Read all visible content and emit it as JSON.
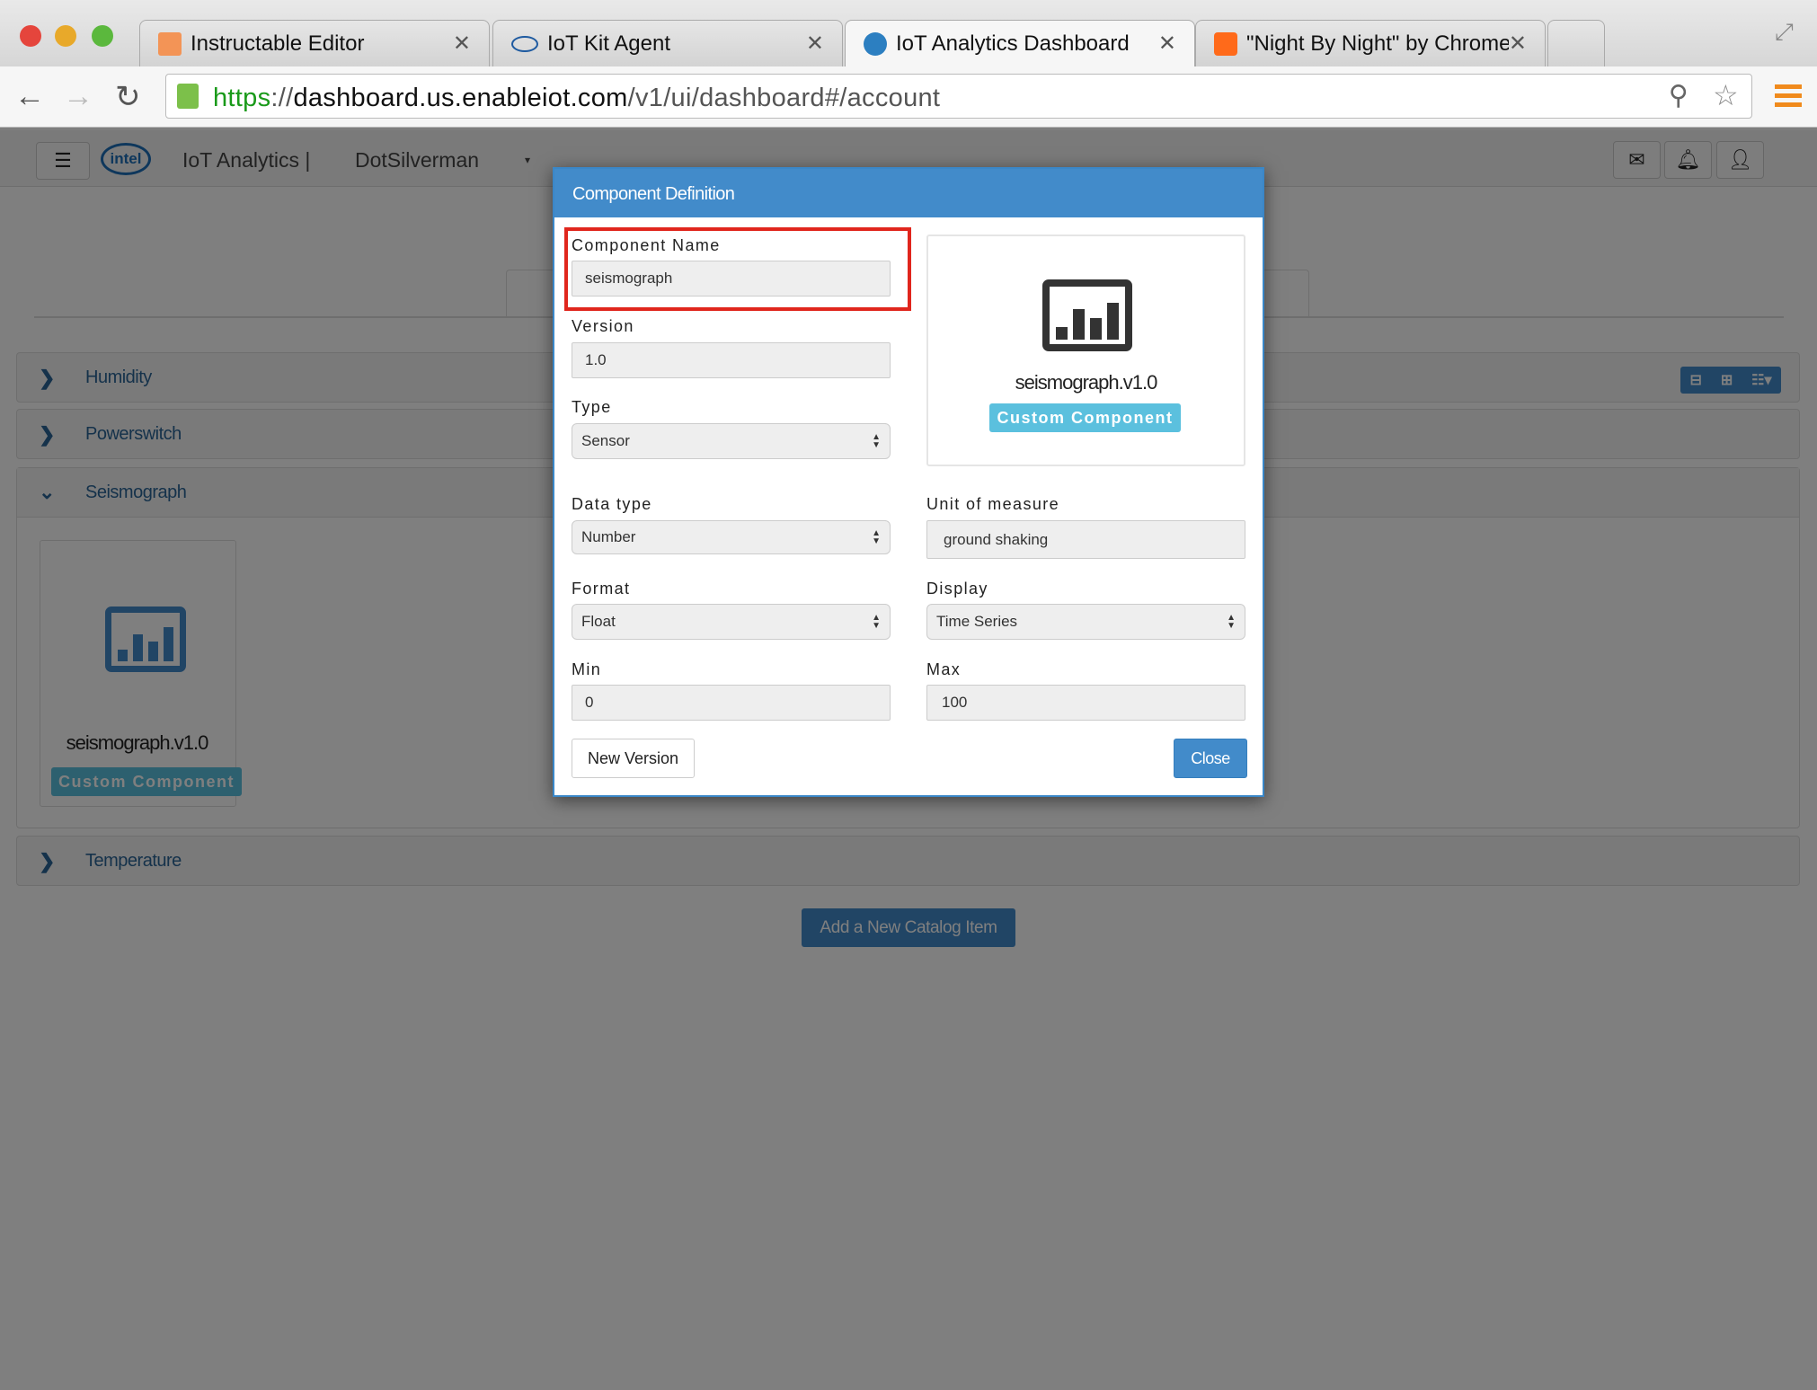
{
  "browser": {
    "tabs": [
      {
        "title": "Instructable Editor",
        "active": false,
        "favicon": "instructables-icon",
        "color": "#f39456"
      },
      {
        "title": "IoT Kit Agent",
        "active": false,
        "favicon": "intel-icon",
        "color": "#1e5aa0"
      },
      {
        "title": "IoT Analytics Dashboard",
        "active": true,
        "favicon": "globe-icon",
        "color": "#2c7fc1"
      },
      {
        "title": "\"Night By Night\" by Chrome",
        "active": false,
        "favicon": "soundcloud-icon",
        "color": "#ff6a1a"
      }
    ],
    "url": {
      "scheme": "https",
      "sep": "://",
      "host": "dashboard.us.enableiot.com",
      "path": "/v1/ui/dashboard#/account"
    }
  },
  "navbar": {
    "brand": "IoT Analytics |",
    "account": "DotSilverman",
    "logo": "intel"
  },
  "catalog": {
    "panels": [
      {
        "label": "Humidity",
        "expanded": false
      },
      {
        "label": "Powerswitch",
        "expanded": false
      },
      {
        "label": "Seismograph",
        "expanded": true
      },
      {
        "label": "Temperature",
        "expanded": false
      }
    ],
    "card": {
      "name": "seismograph.v1.0",
      "badge": "Custom Component"
    },
    "add_button": "Add a New Catalog Item"
  },
  "modal": {
    "title": "Component Definition",
    "fields": {
      "name": {
        "label": "Component Name",
        "value": "seismograph"
      },
      "version": {
        "label": "Version",
        "value": "1.0"
      },
      "type": {
        "label": "Type",
        "value": "Sensor"
      },
      "data_type": {
        "label": "Data type",
        "value": "Number"
      },
      "unit": {
        "label": "Unit of measure",
        "value": "ground shaking"
      },
      "format": {
        "label": "Format",
        "value": "Float"
      },
      "display": {
        "label": "Display",
        "value": "Time Series"
      },
      "min": {
        "label": "Min",
        "value": "0"
      },
      "max": {
        "label": "Max",
        "value": "100"
      }
    },
    "preview": {
      "name": "seismograph.v1.0",
      "badge": "Custom Component"
    },
    "new_version": "New Version",
    "close": "Close",
    "highlight_color": "#e0261d",
    "accent": "#428bca"
  }
}
